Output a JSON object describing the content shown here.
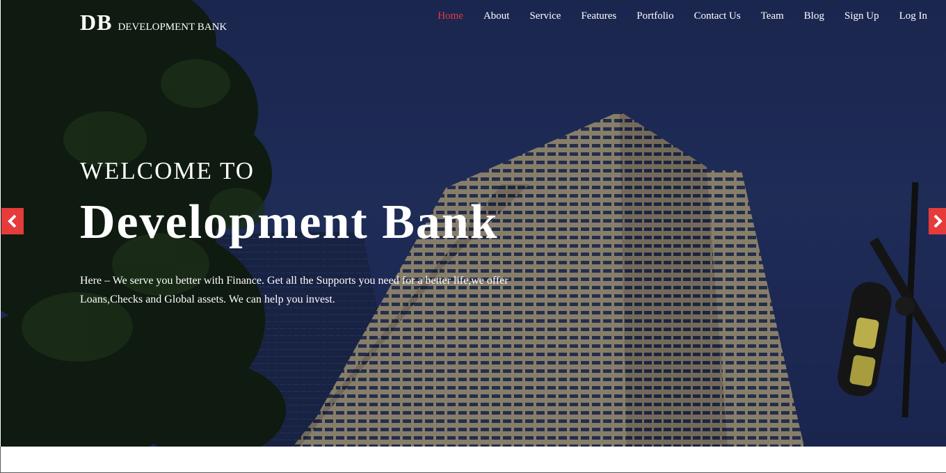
{
  "brand": {
    "mark": "DB",
    "name": "DEVELOPMENT BANK"
  },
  "nav": {
    "items": [
      {
        "label": "Home",
        "active": true
      },
      {
        "label": "About"
      },
      {
        "label": "Service"
      },
      {
        "label": "Features"
      },
      {
        "label": "Portfolio"
      },
      {
        "label": "Contact Us"
      },
      {
        "label": "Team"
      },
      {
        "label": "Blog"
      },
      {
        "label": "Sign Up"
      },
      {
        "label": "Log In"
      }
    ]
  },
  "hero": {
    "welcome": "WELCOME TO",
    "headline": "Development Bank",
    "tagline": "Here – We serve you better with Finance. Get all the Supports you need for a better life,we offer Loans,Checks and Global assets. We can help you invest."
  },
  "carousel": {
    "prev_icon": "chevron-left-icon",
    "next_icon": "chevron-right-icon"
  },
  "colors": {
    "accent": "#e53b3b",
    "sky": "#22305c",
    "text": "#ffffff"
  }
}
